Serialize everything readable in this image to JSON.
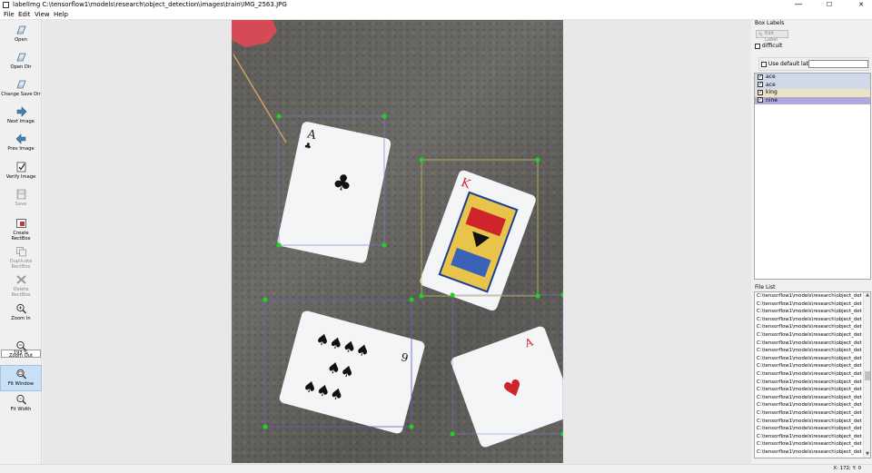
{
  "window": {
    "title": "labelImg C:\\tensorflow1\\models\\research\\object_detection\\images\\train\\IMG_2563.JPG",
    "minimize": "—",
    "maximize": "☐",
    "close": "✕"
  },
  "menu": [
    "File",
    "Edit",
    "View",
    "Help"
  ],
  "toolbar": {
    "open": "Open",
    "open_dir": "Open Dir",
    "change_save_dir": "Change Save Dir",
    "next_image": "Next Image",
    "prev_image": "Prev Image",
    "verify_image": "Verify Image",
    "save": "Save",
    "create_rectbox_1": "Create",
    "create_rectbox_2": "RectBox",
    "duplicate_rectbox_1": "Duplicate",
    "duplicate_rectbox_2": "RectBox",
    "delete_rectbox_1": "Delete",
    "delete_rectbox_2": "RectBox",
    "zoom_in": "Zoom In",
    "zoom_value": "193 %",
    "zoom_out": "Zoom Out",
    "fit_window": "Fit Window",
    "fit_width": "Fit Width"
  },
  "box_labels": {
    "title": "Box Labels",
    "edit_label": "Edit Label",
    "difficult": "difficult",
    "use_default_label": "Use default label",
    "default_label_value": "",
    "labels": [
      {
        "text": "ace",
        "checked": true,
        "color": "#cfd9ea"
      },
      {
        "text": "ace",
        "checked": true,
        "color": "#cfd9ea"
      },
      {
        "text": "king",
        "checked": true,
        "color": "#e8e4c4"
      },
      {
        "text": "nine",
        "checked": true,
        "color": "#b3a6de"
      }
    ]
  },
  "file_list": {
    "title": "File List",
    "items": [
      "C:\\tensorflow1\\models\\research\\object_dete",
      "C:\\tensorflow1\\models\\research\\object_dete",
      "C:\\tensorflow1\\models\\research\\object_dete",
      "C:\\tensorflow1\\models\\research\\object_dete",
      "C:\\tensorflow1\\models\\research\\object_dete",
      "C:\\tensorflow1\\models\\research\\object_dete",
      "C:\\tensorflow1\\models\\research\\object_dete",
      "C:\\tensorflow1\\models\\research\\object_dete",
      "C:\\tensorflow1\\models\\research\\object_dete",
      "C:\\tensorflow1\\models\\research\\object_dete",
      "C:\\tensorflow1\\models\\research\\object_dete",
      "C:\\tensorflow1\\models\\research\\object_dete",
      "C:\\tensorflow1\\models\\research\\object_dete",
      "C:\\tensorflow1\\models\\research\\object_dete",
      "C:\\tensorflow1\\models\\research\\object_dete",
      "C:\\tensorflow1\\models\\research\\object_dete",
      "C:\\tensorflow1\\models\\research\\object_dete",
      "C:\\tensorflow1\\models\\research\\object_dete",
      "C:\\tensorflow1\\models\\research\\object_dete",
      "C:\\tensorflow1\\models\\research\\object_dete",
      "C:\\tensorflow1\\models\\research\\object_dete"
    ]
  },
  "cards": {
    "ace": "A",
    "king": "K",
    "nine": "9"
  },
  "status": {
    "coords": "X: 172; Y: 0"
  }
}
